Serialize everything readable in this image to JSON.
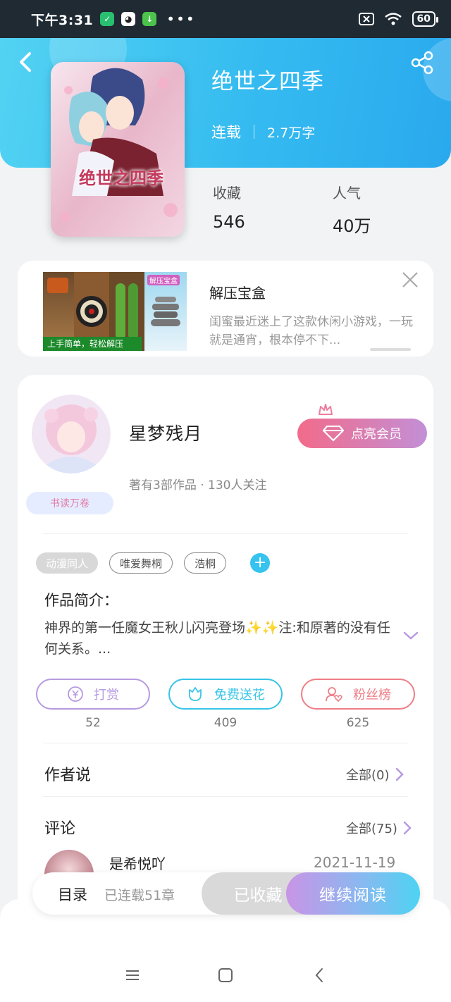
{
  "status_bar": {
    "time": "下午3:31",
    "battery": "60"
  },
  "book": {
    "title": "绝世之四季",
    "status": "连载",
    "word_count": "2.7万字",
    "cover_text": "绝世之四季",
    "stats": [
      {
        "label": "收藏",
        "value": "546"
      },
      {
        "label": "人气",
        "value": "40万"
      }
    ]
  },
  "ad": {
    "title": "解压宝盒",
    "description": "闺蜜最近迷上了这款休闲小游戏，一玩就是通宵，根本停不下...",
    "image_caption": "上手简单，轻松解压",
    "image_badge": "解压宝盒"
  },
  "author": {
    "name": "星梦残月",
    "meta": "著有3部作品 · 130人关注",
    "badge": "书读万卷",
    "vip_label": "点亮会员"
  },
  "tags": [
    "动漫同人",
    "唯爱舞桐",
    "浩桐"
  ],
  "intro": {
    "title": "作品简介：",
    "text": "神界的第一任魔女王秋儿闪亮登场✨✨注:和原著的没有任何关系。..."
  },
  "actions": [
    {
      "label": "打赏",
      "count": "52",
      "color": "#b69ae0"
    },
    {
      "label": "免费送花",
      "count": "409",
      "color": "#38c4e8"
    },
    {
      "label": "粉丝榜",
      "count": "625",
      "color": "#ee7d86"
    }
  ],
  "author_says": {
    "title": "作者说",
    "link": "全部(0)"
  },
  "comments": {
    "title": "评论",
    "link": "全部(75)",
    "first": {
      "user": "是希悦吖",
      "date": "2021-11-19"
    }
  },
  "bottom_bar": {
    "toc_label": "目录",
    "toc_sub": "已连载51章",
    "collected_label": "已收藏",
    "read_label": "继续阅读"
  },
  "colors": {
    "header_gradient": [
      "#52d3f3",
      "#2aa9ee"
    ],
    "accent_purple": "#b69ae0",
    "accent_cyan": "#35c3ef"
  }
}
